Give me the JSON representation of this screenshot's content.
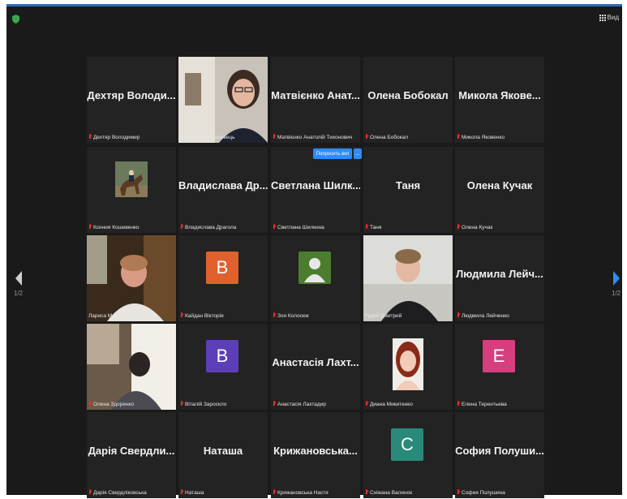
{
  "toolbar": {
    "view_label": "Вид",
    "view_icon": "grid-view-icon",
    "shield_icon": "security-shield-icon"
  },
  "navigation": {
    "prev_page_label": "1/2",
    "next_page_label": "1/2"
  },
  "colors": {
    "background": "#1a1a1a",
    "tile": "#232323",
    "accent_blue": "#2d8cff",
    "muted_red": "#e0302a",
    "active_speaker": "#b9d36a"
  },
  "participants": [
    {
      "name": "Дехтяр Володи...",
      "label": "Дехтяр Володимир",
      "type": "name",
      "muted": true
    },
    {
      "name": "",
      "label": "Юлия Коростышевець",
      "type": "video",
      "muted": false
    },
    {
      "name": "Матвієнко Анат...",
      "label": "Матвієнко Анатолій Тихонович",
      "type": "name",
      "muted": true
    },
    {
      "name": "Олена Бобокал",
      "label": "Олена Бобокал",
      "type": "name",
      "muted": true
    },
    {
      "name": "Микола Якове...",
      "label": "Микола Яковенко",
      "type": "name",
      "muted": true
    },
    {
      "name": "",
      "label": "Ксения Кошевенко",
      "type": "photo",
      "muted": true
    },
    {
      "name": "Владислава Др...",
      "label": "Владислава Драгола",
      "type": "name",
      "muted": true
    },
    {
      "name": "Светлана Шилк...",
      "label": "Светлана Шилкина",
      "type": "name",
      "muted": true
    },
    {
      "name": "Таня",
      "label": "Таня",
      "type": "name",
      "muted": true
    },
    {
      "name": "Олена Кучак",
      "label": "Олена Кучак",
      "type": "name",
      "muted": true
    },
    {
      "name": "",
      "label": "Лариса Масенкова",
      "type": "video",
      "muted": false
    },
    {
      "name": "",
      "label": "Кайдан Вікторія",
      "type": "avatar",
      "initial": "B",
      "color": "#e0602e",
      "muted": true
    },
    {
      "name": "",
      "label": "Зоя Колосюк",
      "type": "default-avatar",
      "muted": true
    },
    {
      "name": "",
      "label": "Гудей Дмитрий",
      "type": "video",
      "muted": false,
      "active": true
    },
    {
      "name": "Людмила Лейч...",
      "label": "Людмила Лейченко",
      "type": "name",
      "muted": true
    },
    {
      "name": "",
      "label": "Олена Здоренко",
      "type": "video",
      "muted": true
    },
    {
      "name": "",
      "label": "Віталій Зароскло",
      "type": "avatar",
      "initial": "B",
      "color": "#5c3fb8",
      "muted": true
    },
    {
      "name": "Анастасія Лахт...",
      "label": "Анастасія Лахтадир",
      "type": "name",
      "muted": true
    },
    {
      "name": "",
      "label": "Диана Микитенко",
      "type": "photo",
      "muted": true
    },
    {
      "name": "",
      "label": "Елена Терентьева",
      "type": "avatar",
      "initial": "E",
      "color": "#d63e7e",
      "muted": true
    },
    {
      "name": "Дарія Свердли...",
      "label": "Дарія Свердліковська",
      "type": "name",
      "muted": true
    },
    {
      "name": "Наташа",
      "label": "Наташа",
      "type": "name",
      "muted": true
    },
    {
      "name": "Крижановська...",
      "label": "Крижановська Настя",
      "type": "name",
      "muted": true
    },
    {
      "name": "",
      "label": "Сніжана Валенок",
      "type": "avatar",
      "initial": "C",
      "color": "#2a8a7a",
      "muted": true
    },
    {
      "name": "София Полуши...",
      "label": "София Полушина",
      "type": "name",
      "muted": true
    }
  ],
  "popup": {
    "ask_label": "Попросить вкл",
    "more_label": "..."
  }
}
